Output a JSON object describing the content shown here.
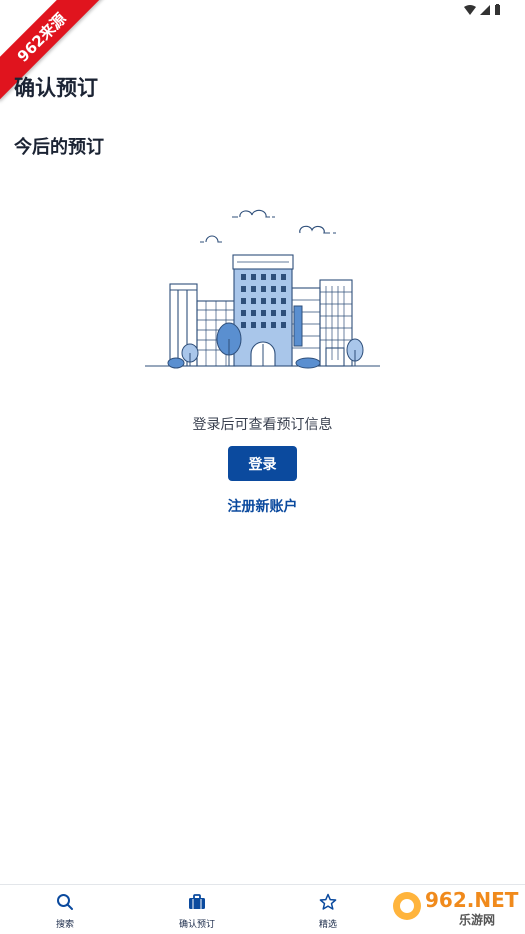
{
  "ribbon": {
    "text": "962来源"
  },
  "page_title": "确认预订",
  "section_title": "今后的预订",
  "empty_state": {
    "message": "登录后可查看预订信息",
    "login_label": "登录",
    "register_label": "注册新账户"
  },
  "bottom_nav": {
    "items": [
      {
        "label": "搜索",
        "icon": "search-icon"
      },
      {
        "label": "确认预订",
        "icon": "briefcase-icon"
      },
      {
        "label": "精选",
        "icon": "star-icon"
      }
    ]
  },
  "watermark": {
    "brand": "962.NET",
    "sub": "乐游网"
  },
  "colors": {
    "accent": "#0b4a9e",
    "ribbon": "#e0141e",
    "illustration": "#5a8fd0"
  }
}
